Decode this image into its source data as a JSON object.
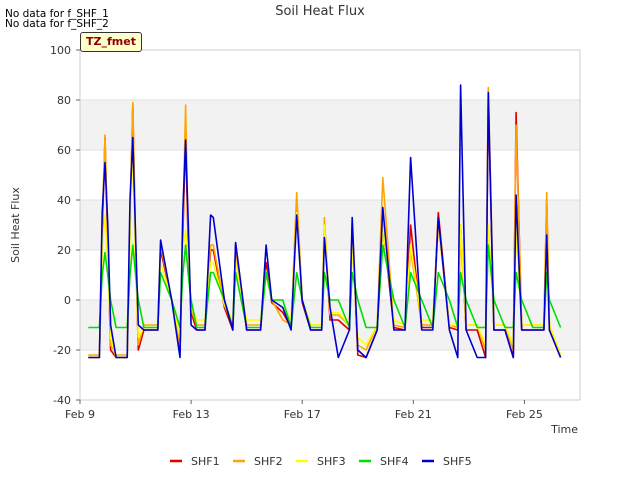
{
  "notes": [
    "No data for f_SHF_1",
    "No data for f_SHF_2"
  ],
  "tz_label": "TZ_fmet",
  "colors": {
    "SHF1": "#dd0000",
    "SHF2": "#ffa500",
    "SHF3": "#ffff00",
    "SHF4": "#00dd00",
    "SHF5": "#0000cc"
  },
  "chart_data": {
    "type": "line",
    "title": "Soil Heat Flux",
    "xlabel": "Time",
    "ylabel": "Soil Heat Flux",
    "ylim": [
      -40,
      100
    ],
    "yticks": [
      -40,
      -20,
      0,
      20,
      40,
      60,
      80,
      100
    ],
    "xlim": [
      0,
      18
    ],
    "x_unit": "days since Feb 9",
    "xticks": [
      {
        "x": 0,
        "label": "Feb 9"
      },
      {
        "x": 4,
        "label": "Feb 13"
      },
      {
        "x": 8,
        "label": "Feb 17"
      },
      {
        "x": 12,
        "label": "Feb 21"
      },
      {
        "x": 16,
        "label": "Feb 25"
      }
    ],
    "legend_position": "bottom",
    "grid": true,
    "series": [
      {
        "name": "SHF1",
        "x": [
          0.3,
          0.7,
          0.8,
          0.9,
          1.0,
          1.1,
          1.3,
          1.7,
          1.8,
          1.9,
          2.0,
          2.1,
          2.3,
          2.8,
          2.9,
          3.3,
          3.6,
          3.7,
          3.8,
          3.9,
          4.0,
          4.2,
          4.5,
          4.7,
          4.8,
          5.2,
          5.5,
          5.6,
          6.0,
          6.5,
          6.7,
          6.9,
          7.3,
          7.6,
          7.8,
          8.0,
          8.3,
          8.7,
          8.8,
          9.0,
          9.3,
          9.7,
          9.8,
          10.0,
          10.3,
          10.7,
          10.9,
          11.3,
          11.7,
          11.9,
          12.3,
          12.7,
          12.9,
          13.3,
          13.6,
          13.7,
          13.9,
          14.3,
          14.6,
          14.7,
          14.9,
          15.3,
          15.6,
          15.7,
          15.9,
          16.3,
          16.7,
          16.8,
          16.9,
          17.3
        ],
        "y": [
          -23,
          -23,
          25,
          65,
          20,
          -20,
          -23,
          -23,
          30,
          78,
          20,
          -20,
          -12,
          -12,
          20,
          0,
          -20,
          25,
          66,
          20,
          -5,
          -12,
          -12,
          20,
          20,
          -3,
          -12,
          22,
          -12,
          -12,
          15,
          -1,
          -5,
          -11,
          40,
          -1,
          -12,
          -12,
          30,
          -8,
          -8,
          -12,
          30,
          -22,
          -23,
          -12,
          30,
          -11,
          -12,
          30,
          -11,
          -11,
          35,
          -11,
          -12,
          30,
          -12,
          -12,
          -23,
          80,
          -12,
          -12,
          -23,
          75,
          -12,
          -12,
          -12,
          40,
          -12,
          -23
        ]
      },
      {
        "name": "SHF2",
        "x": [
          0.3,
          0.7,
          0.8,
          0.9,
          1.0,
          1.1,
          1.3,
          1.7,
          1.8,
          1.9,
          2.0,
          2.1,
          2.3,
          2.8,
          2.9,
          3.3,
          3.6,
          3.7,
          3.8,
          3.9,
          4.0,
          4.2,
          4.5,
          4.7,
          4.8,
          5.2,
          5.5,
          5.6,
          6.0,
          6.5,
          6.7,
          6.9,
          7.3,
          7.6,
          7.8,
          8.0,
          8.3,
          8.7,
          8.8,
          9.0,
          9.3,
          9.7,
          9.8,
          10.0,
          10.3,
          10.7,
          10.9,
          11.3,
          11.7,
          11.9,
          12.3,
          12.7,
          12.9,
          13.3,
          13.6,
          13.7,
          13.9,
          14.3,
          14.6,
          14.7,
          14.9,
          15.3,
          15.6,
          15.7,
          15.9,
          16.3,
          16.7,
          16.8,
          16.9,
          17.3
        ],
        "y": [
          -22,
          -22,
          30,
          66,
          25,
          -18,
          -22,
          -22,
          32,
          79,
          25,
          -18,
          -10,
          -10,
          22,
          0,
          -18,
          28,
          78,
          22,
          -4,
          -10,
          -10,
          22,
          22,
          -2,
          -10,
          20,
          -10,
          -10,
          12,
          0,
          -8,
          -10,
          43,
          0,
          -10,
          -10,
          33,
          -6,
          -6,
          -10,
          28,
          -18,
          -20,
          -10,
          49,
          -10,
          -11,
          20,
          -10,
          -10,
          30,
          -10,
          -11,
          25,
          -10,
          -10,
          -20,
          85,
          -10,
          -10,
          -20,
          70,
          -10,
          -10,
          -10,
          43,
          -10,
          -22
        ]
      },
      {
        "name": "SHF3",
        "x": [
          0.3,
          0.7,
          0.8,
          0.9,
          1.0,
          1.1,
          1.3,
          1.7,
          1.8,
          1.9,
          2.0,
          2.1,
          2.3,
          2.8,
          2.9,
          3.3,
          3.6,
          3.7,
          3.8,
          3.9,
          4.0,
          4.2,
          4.5,
          4.7,
          4.8,
          5.2,
          5.5,
          5.6,
          6.0,
          6.5,
          6.7,
          6.9,
          7.3,
          7.6,
          7.8,
          8.0,
          8.3,
          8.7,
          8.8,
          9.0,
          9.3,
          9.7,
          9.8,
          10.0,
          10.3,
          10.7,
          10.9,
          11.3,
          11.7,
          11.9,
          12.3,
          12.7,
          12.9,
          13.3,
          13.6,
          13.7,
          13.9,
          14.3,
          14.6,
          14.7,
          14.9,
          15.3,
          15.6,
          15.7,
          15.9,
          16.3,
          16.7,
          16.8,
          16.9,
          17.3
        ],
        "y": [
          -23,
          -23,
          20,
          34,
          15,
          -15,
          -23,
          -23,
          25,
          60,
          15,
          -15,
          -11,
          -11,
          15,
          0,
          -15,
          20,
          28,
          15,
          -3,
          -8,
          -8,
          15,
          15,
          -2,
          -8,
          15,
          -8,
          -8,
          10,
          0,
          -3,
          -8,
          35,
          0,
          -10,
          -10,
          30,
          -5,
          -5,
          -10,
          22,
          -15,
          -18,
          -10,
          30,
          -8,
          -10,
          22,
          -8,
          -8,
          30,
          -10,
          -10,
          30,
          -10,
          -10,
          -18,
          30,
          -10,
          -10,
          -18,
          28,
          -10,
          -10,
          -10,
          25,
          -10,
          -22
        ]
      },
      {
        "name": "SHF4",
        "x": [
          0.3,
          0.7,
          0.8,
          0.9,
          1.0,
          1.1,
          1.3,
          1.7,
          1.8,
          1.9,
          2.0,
          2.1,
          2.3,
          2.8,
          2.9,
          3.3,
          3.6,
          3.7,
          3.8,
          3.9,
          4.0,
          4.2,
          4.5,
          4.7,
          4.8,
          5.2,
          5.5,
          5.6,
          6.0,
          6.5,
          6.7,
          6.9,
          7.3,
          7.6,
          7.8,
          8.0,
          8.3,
          8.7,
          8.8,
          9.0,
          9.3,
          9.7,
          9.8,
          10.0,
          10.3,
          10.7,
          10.9,
          11.3,
          11.7,
          11.9,
          12.3,
          12.7,
          12.9,
          13.3,
          13.6,
          13.7,
          13.9,
          14.3,
          14.6,
          14.7,
          14.9,
          15.3,
          15.6,
          15.7,
          15.9,
          16.3,
          16.7,
          16.8,
          16.9,
          17.3
        ],
        "y": [
          -11,
          -11,
          10,
          19,
          10,
          0,
          -11,
          -11,
          10,
          22,
          10,
          0,
          -11,
          -11,
          11,
          0,
          -11,
          10,
          22,
          10,
          0,
          -11,
          -11,
          11,
          11,
          0,
          -11,
          11,
          -11,
          -11,
          11,
          0,
          0,
          -11,
          11,
          0,
          -11,
          -11,
          11,
          0,
          0,
          -11,
          11,
          0,
          -11,
          -11,
          22,
          0,
          -11,
          11,
          0,
          -11,
          11,
          0,
          -11,
          11,
          0,
          -11,
          -11,
          22,
          0,
          -11,
          -11,
          11,
          0,
          -11,
          -11,
          11,
          0,
          -11
        ]
      },
      {
        "name": "SHF5",
        "x": [
          0.3,
          0.7,
          0.8,
          0.9,
          1.0,
          1.1,
          1.3,
          1.7,
          1.8,
          1.9,
          2.0,
          2.1,
          2.3,
          2.8,
          2.9,
          3.3,
          3.6,
          3.7,
          3.8,
          3.9,
          4.0,
          4.2,
          4.5,
          4.7,
          4.8,
          5.2,
          5.5,
          5.6,
          6.0,
          6.5,
          6.7,
          6.9,
          7.3,
          7.6,
          7.8,
          8.0,
          8.3,
          8.7,
          8.8,
          9.0,
          9.3,
          9.7,
          9.8,
          10.0,
          10.3,
          10.7,
          10.9,
          11.3,
          11.7,
          11.9,
          12.3,
          12.7,
          12.9,
          13.3,
          13.6,
          13.7,
          13.9,
          14.3,
          14.6,
          14.7,
          14.9,
          15.3,
          15.6,
          15.7,
          15.9,
          16.3,
          16.7,
          16.8,
          16.9,
          17.3
        ],
        "y": [
          -23,
          -23,
          35,
          55,
          30,
          -10,
          -23,
          -23,
          40,
          65,
          25,
          -10,
          -12,
          -12,
          24,
          0,
          -23,
          35,
          64,
          30,
          -10,
          -12,
          -12,
          34,
          33,
          0,
          -12,
          23,
          -12,
          -12,
          22,
          0,
          -3,
          -12,
          34,
          0,
          -12,
          -12,
          25,
          -3,
          -23,
          -12,
          33,
          -20,
          -23,
          -12,
          37,
          -12,
          -12,
          57,
          -12,
          -12,
          33,
          -12,
          -23,
          86,
          -12,
          -23,
          -23,
          83,
          -12,
          -12,
          -23,
          42,
          -12,
          -12,
          -12,
          26,
          -12,
          -23
        ]
      }
    ]
  }
}
